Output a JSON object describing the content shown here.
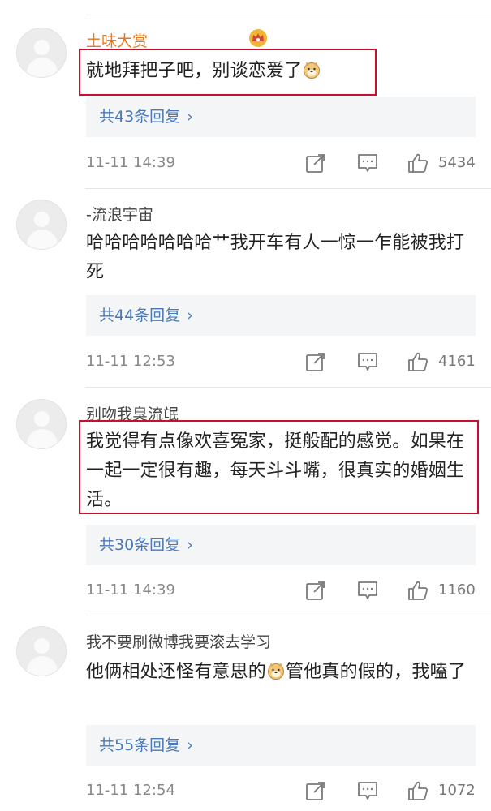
{
  "comments": [
    {
      "user": "土味大赏",
      "text": "就地拜把子吧，别谈恋爱了",
      "text_suffix_emoji": "doge-emoji",
      "replies": "共43条回复",
      "time": "11-11 14:39",
      "likes": "5434"
    },
    {
      "user": "-流浪宇宙",
      "text": "哈哈哈哈哈哈哈艹我开车有人一惊一乍能被我打死",
      "replies": "共44条回复",
      "time": "11-11 12:53",
      "likes": "4161"
    },
    {
      "user": "别吻我臭流氓",
      "text": "我觉得有点像欢喜冤家，挺般配的感觉。如果在一起一定很有趣，每天斗斗嘴，很真实的婚姻生活。",
      "replies": "共30条回复",
      "time": "11-11 14:39",
      "likes": "1160"
    },
    {
      "user": "我不要刷微博我要滚去学习",
      "text_before_emoji": "他俩相处还怪有意思的",
      "text_after_emoji": "管他真的假的，我嗑了",
      "replies": "共55条回复",
      "time": "11-11 12:54",
      "likes": "1072"
    }
  ],
  "ui": {
    "chevron": "›",
    "highlight_color": "#c8102e",
    "link_color": "#4a78b8",
    "vip_name_color": "#e8781b"
  }
}
